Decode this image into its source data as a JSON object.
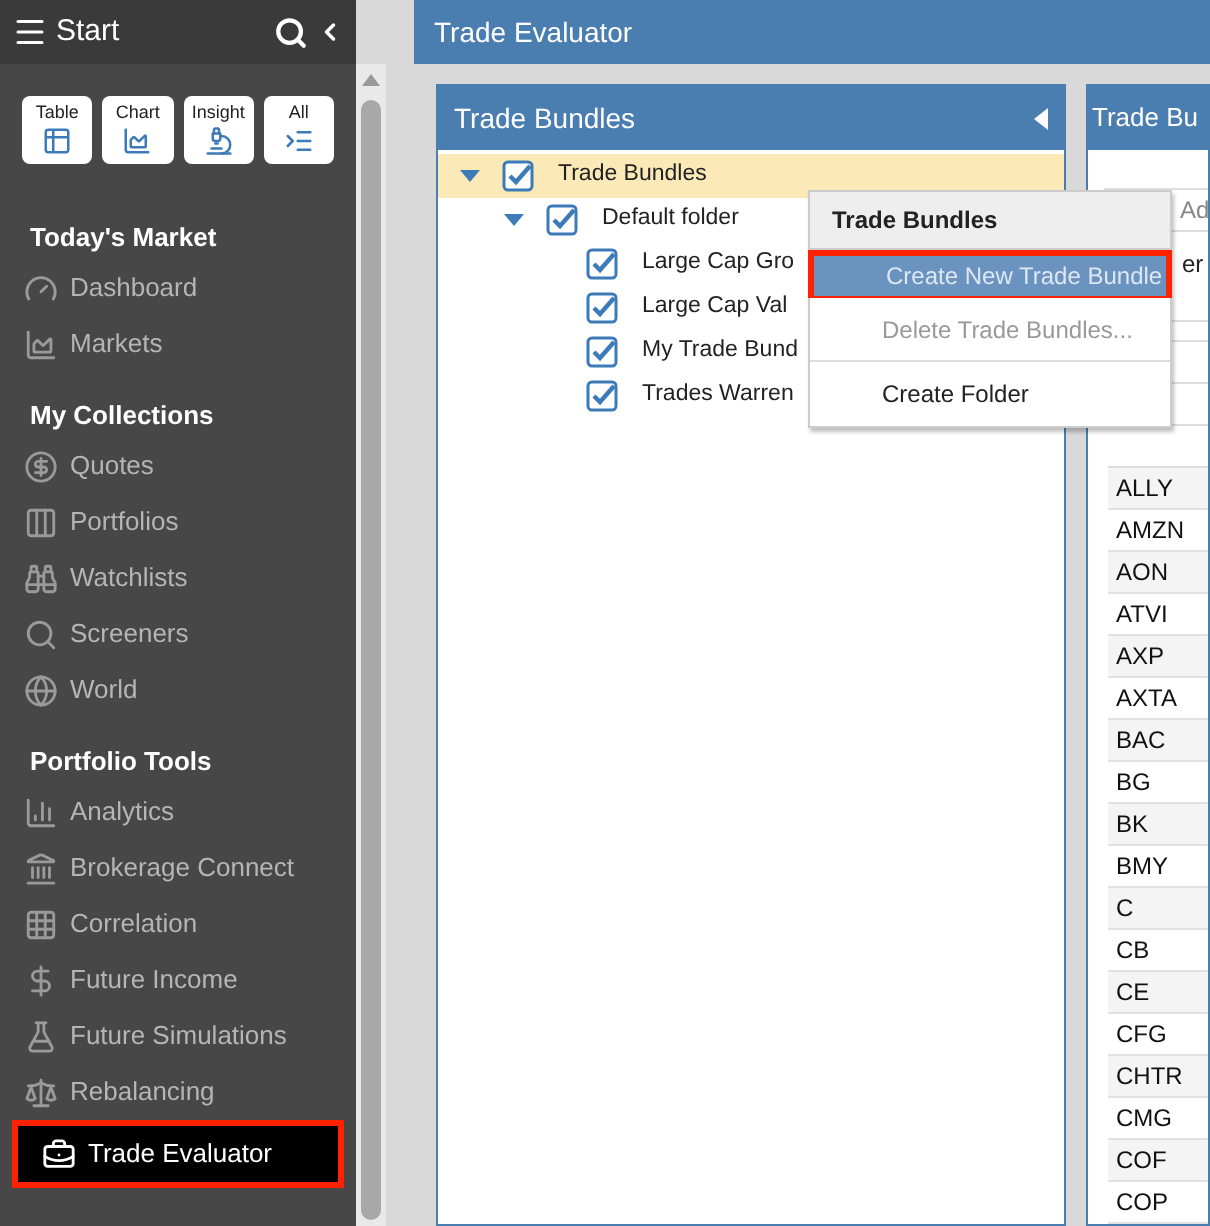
{
  "sidebar": {
    "title": "Start",
    "quick_buttons": [
      "Table",
      "Chart",
      "Insight",
      "All"
    ],
    "sections": [
      {
        "heading": "Today's Market",
        "items": [
          {
            "label": "Dashboard",
            "selected": false
          },
          {
            "label": "Markets",
            "selected": false
          }
        ]
      },
      {
        "heading": "My Collections",
        "items": [
          {
            "label": "Quotes",
            "selected": false
          },
          {
            "label": "Portfolios",
            "selected": false
          },
          {
            "label": "Watchlists",
            "selected": false
          },
          {
            "label": "Screeners",
            "selected": false
          },
          {
            "label": "World",
            "selected": false
          }
        ]
      },
      {
        "heading": "Portfolio Tools",
        "items": [
          {
            "label": "Analytics",
            "selected": false
          },
          {
            "label": "Brokerage Connect",
            "selected": false
          },
          {
            "label": "Correlation",
            "selected": false
          },
          {
            "label": "Future Income",
            "selected": false
          },
          {
            "label": "Future Simulations",
            "selected": false
          },
          {
            "label": "Rebalancing",
            "selected": false
          },
          {
            "label": "Trade Evaluator",
            "selected": true
          }
        ]
      }
    ]
  },
  "header": {
    "title": "Trade Evaluator"
  },
  "bundles_panel": {
    "title": "Trade Bundles",
    "tree": [
      {
        "label": "Trade Bundles",
        "checked": true,
        "expanded": true,
        "selected": true,
        "children": [
          {
            "label": "Default folder",
            "checked": true,
            "expanded": true,
            "selected": false,
            "children": [
              {
                "label": "Large Cap Gro",
                "checked": true,
                "selected": false
              },
              {
                "label": "Large Cap Val",
                "checked": true,
                "selected": false
              },
              {
                "label": "My Trade Bund",
                "checked": true,
                "selected": false
              },
              {
                "label": "Trades Warren",
                "checked": true,
                "selected": false
              }
            ]
          }
        ]
      }
    ]
  },
  "context_menu": {
    "title": "Trade Bundles",
    "items": [
      {
        "label": "Create New Trade Bundle",
        "highlighted": true,
        "disabled": false
      },
      {
        "label": "Delete Trade Bundles...",
        "highlighted": false,
        "disabled": true
      },
      {
        "label": "Create Folder",
        "highlighted": false,
        "disabled": false
      }
    ]
  },
  "detail_panel": {
    "title": "Trade Bu",
    "search": {
      "placeholder": "Ad"
    },
    "column_header": "er",
    "tickers": [
      "ALLY",
      "AMZN",
      "AON",
      "ATVI",
      "AXP",
      "AXTA",
      "BAC",
      "BG",
      "BK",
      "BMY",
      "C",
      "CB",
      "CE",
      "CFG",
      "CHTR",
      "CMG",
      "COF",
      "COP"
    ]
  }
}
